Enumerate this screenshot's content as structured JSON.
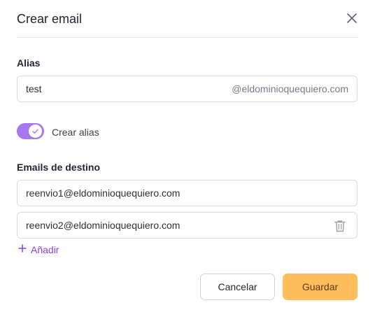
{
  "dialog": {
    "title": "Crear email",
    "close_icon": "close-icon"
  },
  "alias": {
    "label": "Alias",
    "value": "test",
    "domain_suffix": "@eldominioquequiero.com"
  },
  "toggle": {
    "label": "Crear alias",
    "checked": true,
    "color": "#a777f0"
  },
  "destinations": {
    "label": "Emails de destino",
    "items": [
      {
        "value": "reenvio1@eldominioquequiero.com",
        "deletable": false
      },
      {
        "value": "reenvio2@eldominioquequiero.com",
        "deletable": true
      }
    ],
    "add_label": "Añadir",
    "add_icon": "plus-icon",
    "delete_icon": "trash-icon",
    "accent_color": "#8b3fe0"
  },
  "actions": {
    "cancel_label": "Cancelar",
    "save_label": "Guardar",
    "save_color": "#ffbd5c"
  }
}
